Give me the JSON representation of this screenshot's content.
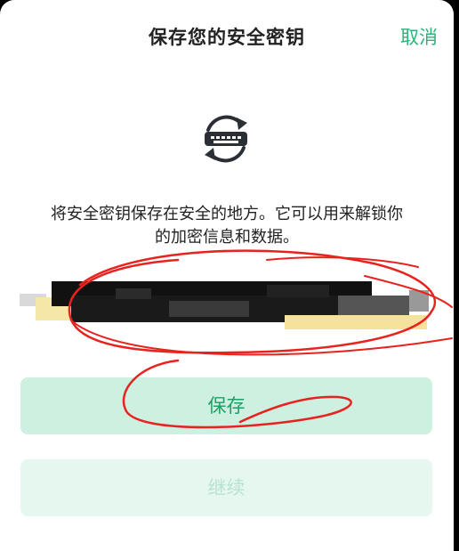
{
  "header": {
    "title": "保存您的安全密钥",
    "cancel_label": "取消"
  },
  "icon": {
    "name": "security-key-sync-icon"
  },
  "description": {
    "line1": "将安全密钥保存在安全的地方。它可以用来解锁你",
    "line2": "的加密信息和数据。"
  },
  "key_field": {
    "state": "redacted"
  },
  "buttons": {
    "save_label": "保存",
    "continue_label": "继续"
  },
  "colors": {
    "accent": "#2bb37a",
    "save_bg": "#cdf0e1",
    "continue_bg": "#e6f7f0",
    "annotation_red": "#e8231f"
  }
}
